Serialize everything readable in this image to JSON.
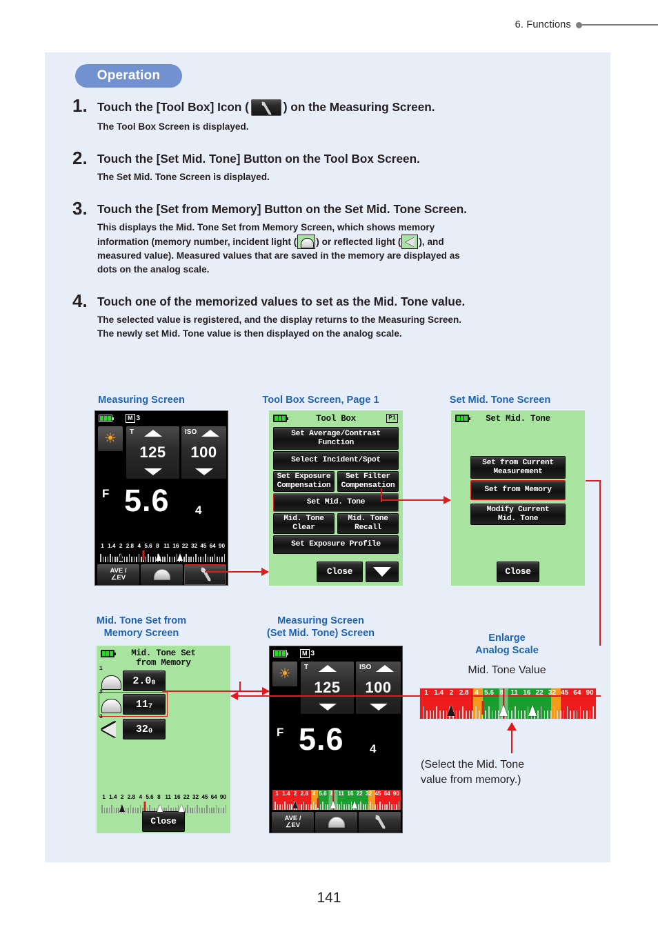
{
  "header": {
    "title": "6.  Functions"
  },
  "operation": {
    "badge": "Operation"
  },
  "steps": [
    {
      "num": "1.",
      "head_before": "Touch the [Tool Box] Icon (",
      "head_after": ") on the Measuring Screen.",
      "body": "The Tool Box Screen is displayed."
    },
    {
      "num": "2.",
      "head": "Touch the [Set Mid. Tone] Button on the Tool Box Screen.",
      "body": "The Set Mid. Tone Screen is displayed."
    },
    {
      "num": "3.",
      "head": "Touch the [Set from Memory] Button on the Set Mid. Tone Screen.",
      "body_1": "This displays the Mid. Tone Set from Memory Screen, which shows memory",
      "body_2": "information (memory number, incident light (",
      "body_3": ") or reflected light (",
      "body_4": "), and",
      "body_5": "measured value). Measured values that are saved in the memory are displayed as",
      "body_6": "dots on the analog scale."
    },
    {
      "num": "4.",
      "head": "Touch one of the memorized values to set as the Mid. Tone value.",
      "body": "The selected value is registered, and the display returns to the Measuring Screen.\nThe newly set Mid. Tone value is then displayed on the analog scale."
    }
  ],
  "figures": {
    "measuring_screen": {
      "caption": "Measuring Screen",
      "memory_label": "M",
      "memory_number": "3",
      "shutter_label": "T",
      "shutter_value": "125",
      "iso_label": "ISO",
      "iso_value": "100",
      "f_label": "F",
      "f_value": "5.6",
      "f_sub": "4",
      "buttons": {
        "ave": "AVE /",
        "ave2": "∠EV",
        "dome_icon": "dome-icon",
        "toolbox_icon": "wrench-icon"
      },
      "scale_labels": [
        "1",
        "1.4",
        "2",
        "2.8",
        "4",
        "5.6",
        "8",
        "11",
        "16",
        "22",
        "32",
        "45",
        "64",
        "90"
      ]
    },
    "tool_box": {
      "caption": "Tool Box Screen, Page 1",
      "title": "Tool Box",
      "page_badge": "P1",
      "buttons": [
        "Set Average/Contrast\nFunction",
        "Select Incident/Spot",
        "Set Exposure\nCompensation",
        "Set Filter\nCompensation",
        "Set Mid. Tone",
        "Mid. Tone\nClear",
        "Mid. Tone\nRecall",
        "Set Exposure Profile"
      ],
      "close": "Close",
      "next_page_icon": "chevron-down-icon"
    },
    "set_mid_tone": {
      "caption": "Set Mid. Tone Screen",
      "title": "Set Mid. Tone",
      "buttons": [
        "Set from Current\nMeasurement",
        "Set from Memory",
        "Modify Current\nMid. Tone"
      ],
      "close": "Close"
    },
    "mid_tone_memory": {
      "caption_1": "Mid. Tone Set from",
      "caption_2": "Memory Screen",
      "title_1": "Mid. Tone Set",
      "title_2": "from Memory",
      "rows": [
        {
          "num": "1",
          "icon": "dome-icon",
          "value": "2.0",
          "sub": "0"
        },
        {
          "num": "2",
          "icon": "dome-icon",
          "value": "11",
          "sub": "7"
        },
        {
          "num": "3",
          "icon": "spot-icon",
          "value": "32",
          "sub": "0"
        }
      ],
      "close": "Close",
      "scale_labels": [
        "1",
        "1.4",
        "2",
        "2.8",
        "4",
        "5.6",
        "8",
        "11",
        "16",
        "22",
        "32",
        "45",
        "64",
        "90"
      ]
    },
    "measuring_set_mid_tone": {
      "caption_1": "Measuring Screen",
      "caption_2": "(Set Mid. Tone) Screen",
      "memory_label": "M",
      "memory_number": "3",
      "shutter_label": "T",
      "shutter_value": "125",
      "iso_label": "ISO",
      "iso_value": "100",
      "f_label": "F",
      "f_value": "5.6",
      "f_sub": "4",
      "buttons": {
        "ave": "AVE /",
        "ave2": "∠EV"
      },
      "scale_labels": [
        "1",
        "1.4",
        "2",
        "2.8",
        "4",
        "5.6",
        "8",
        "11",
        "16",
        "22",
        "32",
        "45",
        "64",
        "90"
      ]
    },
    "enlarge": {
      "caption_1": "Enlarge",
      "caption_2": "Analog Scale",
      "mid_tone_label": "Mid. Tone Value",
      "note_1": "(Select the Mid. Tone",
      "note_2": "value from memory.)",
      "scale_labels": [
        "1",
        "1.4",
        "2",
        "2.8",
        "4",
        "5.6",
        "8",
        "11",
        "16",
        "22",
        "32",
        "45",
        "64",
        "90"
      ]
    }
  },
  "colors": {
    "panel_bg": "#e8eef7",
    "badge_bg": "#7191d0",
    "caption_blue": "#1f63b4",
    "lcd_green": "#a8e4a0",
    "accent_red": "#e01b1b",
    "band_red": "#ee1c1c",
    "band_orange": "#f59b1c",
    "band_green": "#1a9e2e"
  },
  "page_number": "141"
}
